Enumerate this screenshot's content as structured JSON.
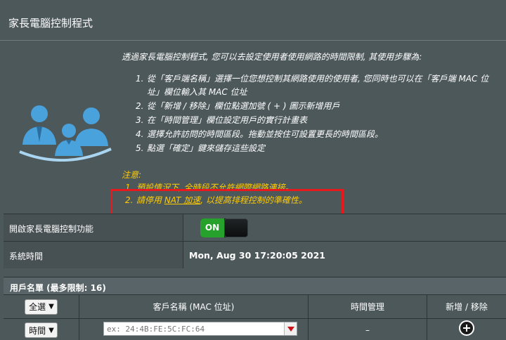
{
  "page": {
    "title": "家長電腦控制程式"
  },
  "intro": {
    "text": "透過家長電腦控制程式, 您可以去設定使用者使用網路的時間限制, 其使用步驟為:"
  },
  "steps": [
    {
      "num": "1.",
      "text": "從「客戶端名稱」選擇一位您想控制其網路使用的使用者, 您同時也可以在「客戶端 MAC 位址」欄位輸入其 MAC 位址"
    },
    {
      "num": "2.",
      "text": "從「新增 / 移除」欄位點選加號 ( + ) 圖示新增用戶"
    },
    {
      "num": "3.",
      "text": "在「時間管理」欄位設定用戶的實行計畫表"
    },
    {
      "num": "4.",
      "text": "選擇允許訪問的時間區段。拖動並按住可設置更長的時間區段。"
    },
    {
      "num": "5.",
      "text": "點選「確定」鍵來儲存這些設定"
    }
  ],
  "notes": {
    "heading": "注意:",
    "items": [
      {
        "num": "1.",
        "text": "預設情況下, 全時段不允許網際網路連接。"
      },
      {
        "num": "2.",
        "pre": "請停用 ",
        "link": "NAT 加速",
        "post": ", 以提高排程控制的準確性。"
      }
    ]
  },
  "settings": {
    "enable_label": "開啟家長電腦控制功能",
    "toggle_on": "ON",
    "toggle_state": true,
    "system_time_label": "系統時間",
    "system_time_value": "Mon, Aug 30 17:20:05 2021"
  },
  "client_list": {
    "header": "用戶名單 (最多限制: 16)",
    "select_all": "全選",
    "col_client": "客戶名稱 (MAC 位址)",
    "col_time": "時間管理",
    "col_add": "新增 / 移除",
    "row_select": "時間",
    "client_placeholder": "ex: 24:4B:FE:5C:FC:64",
    "time_value": "–"
  },
  "colors": {
    "background": "#4d585b",
    "toggle_on": "#25a12c",
    "note_text": "#ffcc00",
    "highlight_border": "#e8181c"
  },
  "icons": {
    "family": "family-icon",
    "add": "add-circle-icon",
    "dropdown": "chevron-down-icon",
    "combo": "dropdown-arrow-icon"
  }
}
